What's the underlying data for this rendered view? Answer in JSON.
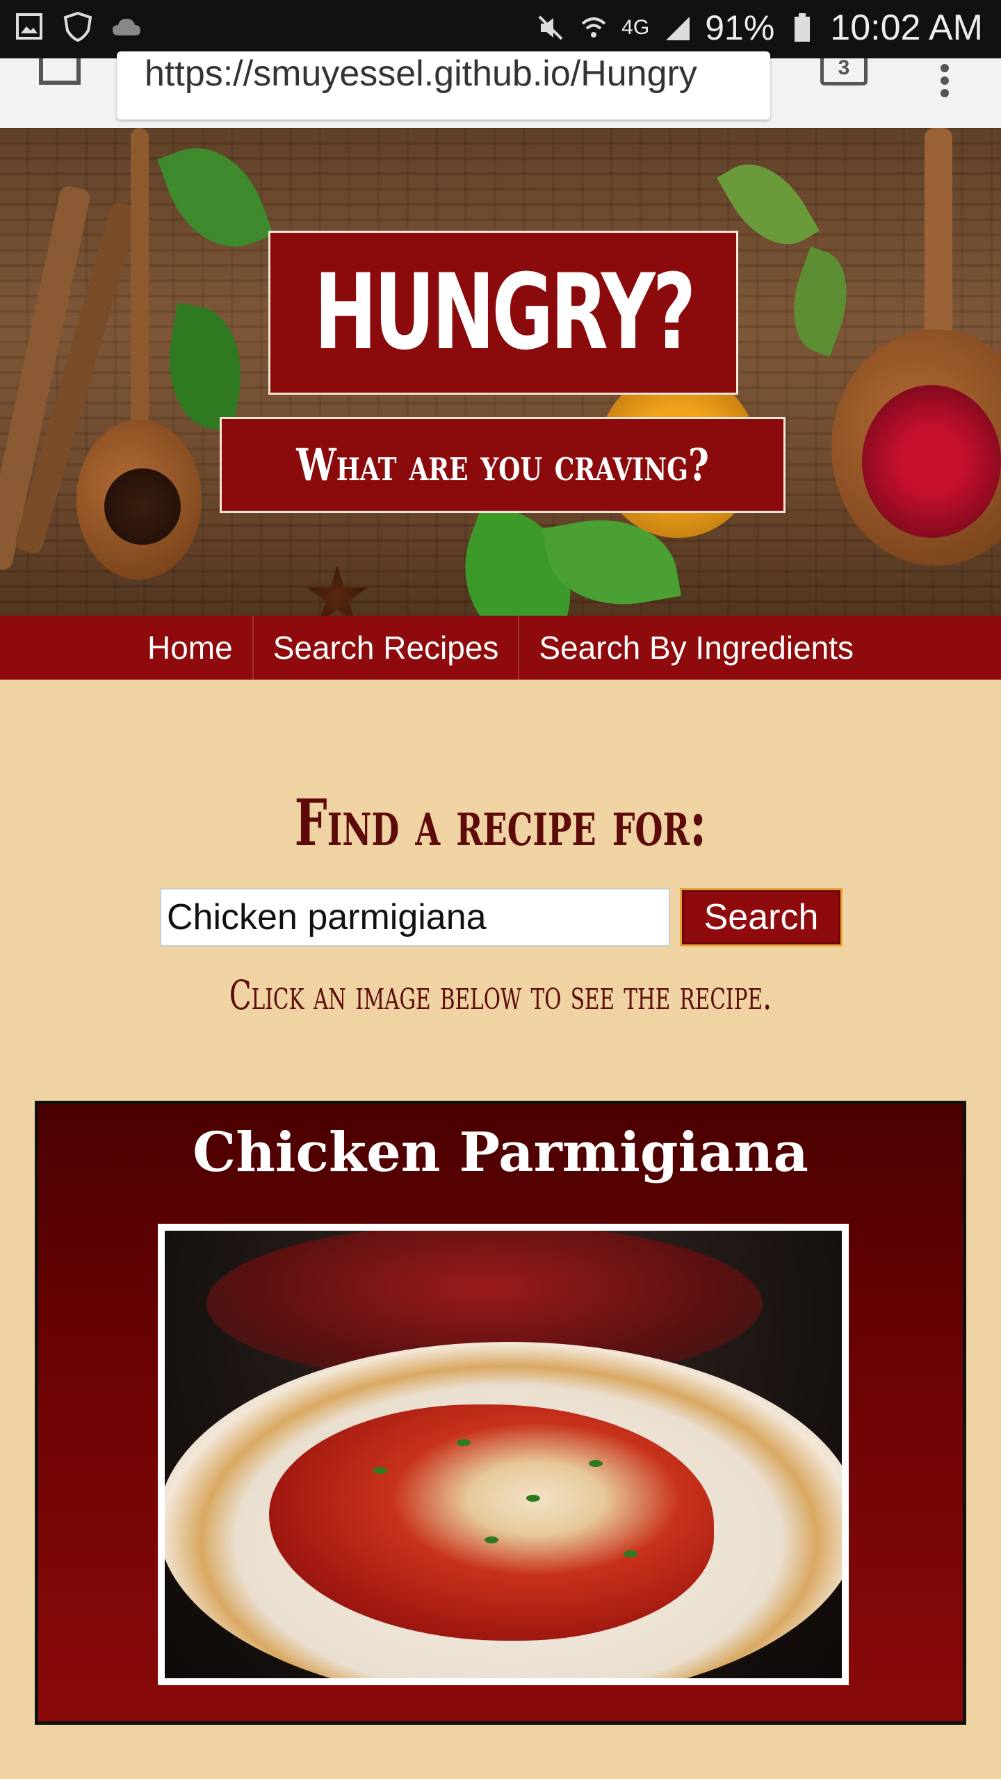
{
  "status_bar": {
    "battery": "91%",
    "time": "10:02 AM",
    "network": "4G"
  },
  "browser": {
    "url": "https://smuyessel.github.io/Hungry",
    "tab_count": "3"
  },
  "hero": {
    "title": "HUNGRY?",
    "subtitle": "What are you craving?"
  },
  "nav": {
    "items": [
      {
        "label": "Home"
      },
      {
        "label": "Search Recipes"
      },
      {
        "label": "Search By Ingredients"
      }
    ]
  },
  "search": {
    "heading": "Find a recipe for:",
    "input_value": "Chicken parmigiana",
    "button_label": "Search",
    "hint": "Click an image below to see the recipe."
  },
  "results": [
    {
      "title": "Chicken Parmigiana"
    }
  ],
  "colors": {
    "brand_red": "#8f0a0c",
    "background": "#efd3a2",
    "heading_text": "#5c0a0a"
  }
}
